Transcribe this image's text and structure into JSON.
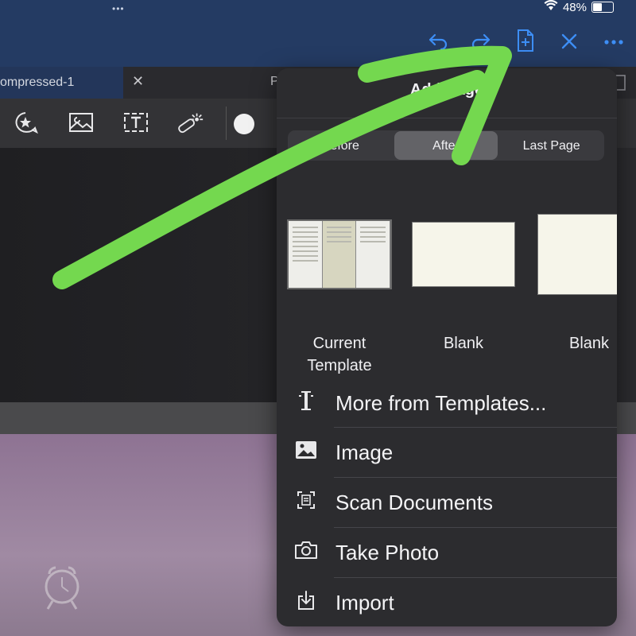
{
  "status": {
    "dots": "•••",
    "battery": "48%"
  },
  "nav": {
    "undo_icon": "undo-icon",
    "redo_icon": "redo-icon",
    "add_page_icon": "add-page-icon",
    "close_icon": "close-icon",
    "more_icon": "more-icon"
  },
  "tab": {
    "title": "ompressed-1",
    "close": "✕",
    "partial": "P"
  },
  "popover": {
    "title": "Add Page",
    "segments": [
      "Before",
      "After",
      "Last Page"
    ],
    "selected_segment": "After",
    "templates": [
      {
        "label": "Current\nTemplate"
      },
      {
        "label": "Blank"
      },
      {
        "label": "Blank"
      }
    ],
    "menu": [
      {
        "label": "More from Templates...",
        "icon": "templates-icon"
      },
      {
        "label": "Image",
        "icon": "image-icon"
      },
      {
        "label": "Scan Documents",
        "icon": "scan-icon"
      },
      {
        "label": "Take Photo",
        "icon": "camera-icon"
      },
      {
        "label": "Import",
        "icon": "import-icon"
      }
    ]
  },
  "colors": {
    "accent": "#3d8ef5",
    "nav": "#243b63",
    "arrow": "#74d84f"
  }
}
